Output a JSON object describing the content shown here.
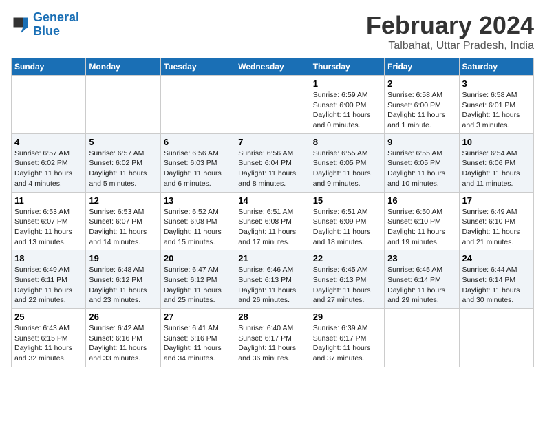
{
  "header": {
    "logo_general": "General",
    "logo_blue": "Blue",
    "main_title": "February 2024",
    "sub_title": "Talbahat, Uttar Pradesh, India"
  },
  "days_of_week": [
    "Sunday",
    "Monday",
    "Tuesday",
    "Wednesday",
    "Thursday",
    "Friday",
    "Saturday"
  ],
  "weeks": [
    [
      {
        "day": "",
        "info": ""
      },
      {
        "day": "",
        "info": ""
      },
      {
        "day": "",
        "info": ""
      },
      {
        "day": "",
        "info": ""
      },
      {
        "day": "1",
        "info": "Sunrise: 6:59 AM\nSunset: 6:00 PM\nDaylight: 11 hours\nand 0 minutes."
      },
      {
        "day": "2",
        "info": "Sunrise: 6:58 AM\nSunset: 6:00 PM\nDaylight: 11 hours\nand 1 minute."
      },
      {
        "day": "3",
        "info": "Sunrise: 6:58 AM\nSunset: 6:01 PM\nDaylight: 11 hours\nand 3 minutes."
      }
    ],
    [
      {
        "day": "4",
        "info": "Sunrise: 6:57 AM\nSunset: 6:02 PM\nDaylight: 11 hours\nand 4 minutes."
      },
      {
        "day": "5",
        "info": "Sunrise: 6:57 AM\nSunset: 6:02 PM\nDaylight: 11 hours\nand 5 minutes."
      },
      {
        "day": "6",
        "info": "Sunrise: 6:56 AM\nSunset: 6:03 PM\nDaylight: 11 hours\nand 6 minutes."
      },
      {
        "day": "7",
        "info": "Sunrise: 6:56 AM\nSunset: 6:04 PM\nDaylight: 11 hours\nand 8 minutes."
      },
      {
        "day": "8",
        "info": "Sunrise: 6:55 AM\nSunset: 6:05 PM\nDaylight: 11 hours\nand 9 minutes."
      },
      {
        "day": "9",
        "info": "Sunrise: 6:55 AM\nSunset: 6:05 PM\nDaylight: 11 hours\nand 10 minutes."
      },
      {
        "day": "10",
        "info": "Sunrise: 6:54 AM\nSunset: 6:06 PM\nDaylight: 11 hours\nand 11 minutes."
      }
    ],
    [
      {
        "day": "11",
        "info": "Sunrise: 6:53 AM\nSunset: 6:07 PM\nDaylight: 11 hours\nand 13 minutes."
      },
      {
        "day": "12",
        "info": "Sunrise: 6:53 AM\nSunset: 6:07 PM\nDaylight: 11 hours\nand 14 minutes."
      },
      {
        "day": "13",
        "info": "Sunrise: 6:52 AM\nSunset: 6:08 PM\nDaylight: 11 hours\nand 15 minutes."
      },
      {
        "day": "14",
        "info": "Sunrise: 6:51 AM\nSunset: 6:08 PM\nDaylight: 11 hours\nand 17 minutes."
      },
      {
        "day": "15",
        "info": "Sunrise: 6:51 AM\nSunset: 6:09 PM\nDaylight: 11 hours\nand 18 minutes."
      },
      {
        "day": "16",
        "info": "Sunrise: 6:50 AM\nSunset: 6:10 PM\nDaylight: 11 hours\nand 19 minutes."
      },
      {
        "day": "17",
        "info": "Sunrise: 6:49 AM\nSunset: 6:10 PM\nDaylight: 11 hours\nand 21 minutes."
      }
    ],
    [
      {
        "day": "18",
        "info": "Sunrise: 6:49 AM\nSunset: 6:11 PM\nDaylight: 11 hours\nand 22 minutes."
      },
      {
        "day": "19",
        "info": "Sunrise: 6:48 AM\nSunset: 6:12 PM\nDaylight: 11 hours\nand 23 minutes."
      },
      {
        "day": "20",
        "info": "Sunrise: 6:47 AM\nSunset: 6:12 PM\nDaylight: 11 hours\nand 25 minutes."
      },
      {
        "day": "21",
        "info": "Sunrise: 6:46 AM\nSunset: 6:13 PM\nDaylight: 11 hours\nand 26 minutes."
      },
      {
        "day": "22",
        "info": "Sunrise: 6:45 AM\nSunset: 6:13 PM\nDaylight: 11 hours\nand 27 minutes."
      },
      {
        "day": "23",
        "info": "Sunrise: 6:45 AM\nSunset: 6:14 PM\nDaylight: 11 hours\nand 29 minutes."
      },
      {
        "day": "24",
        "info": "Sunrise: 6:44 AM\nSunset: 6:14 PM\nDaylight: 11 hours\nand 30 minutes."
      }
    ],
    [
      {
        "day": "25",
        "info": "Sunrise: 6:43 AM\nSunset: 6:15 PM\nDaylight: 11 hours\nand 32 minutes."
      },
      {
        "day": "26",
        "info": "Sunrise: 6:42 AM\nSunset: 6:16 PM\nDaylight: 11 hours\nand 33 minutes."
      },
      {
        "day": "27",
        "info": "Sunrise: 6:41 AM\nSunset: 6:16 PM\nDaylight: 11 hours\nand 34 minutes."
      },
      {
        "day": "28",
        "info": "Sunrise: 6:40 AM\nSunset: 6:17 PM\nDaylight: 11 hours\nand 36 minutes."
      },
      {
        "day": "29",
        "info": "Sunrise: 6:39 AM\nSunset: 6:17 PM\nDaylight: 11 hours\nand 37 minutes."
      },
      {
        "day": "",
        "info": ""
      },
      {
        "day": "",
        "info": ""
      }
    ]
  ]
}
